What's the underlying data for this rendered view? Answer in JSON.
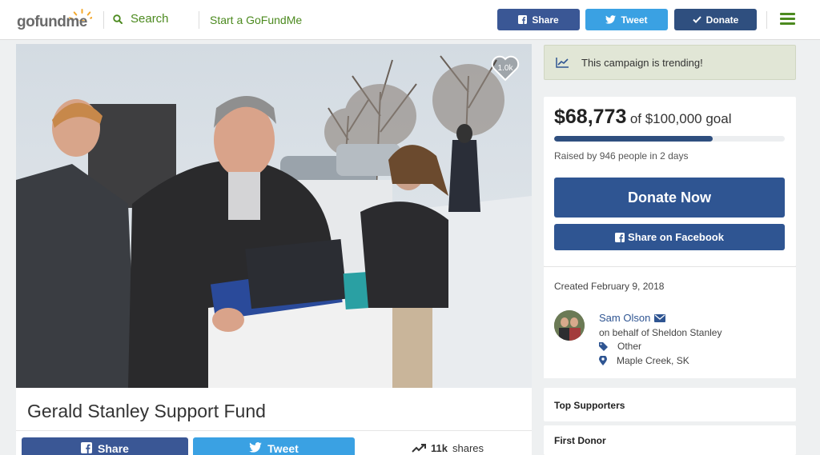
{
  "header": {
    "logo": {
      "part1": "go",
      "part2": "fund",
      "part3": "me"
    },
    "search_label": "Search",
    "start_label": "Start a GoFundMe",
    "share_label": "Share",
    "tweet_label": "Tweet",
    "donate_label": "Donate"
  },
  "hero": {
    "heart_count": "1.0k",
    "photo_icon": "campaign-photo"
  },
  "campaign": {
    "title": "Gerald Stanley Support Fund",
    "share_label": "Share",
    "tweet_label": "Tweet",
    "shares_count": "11k",
    "shares_suffix": "shares"
  },
  "sidebar": {
    "trending_text": "This campaign is trending!",
    "amount_raised": "$68,773",
    "goal_text": "of $100,000 goal",
    "progress_fraction": 0.68773,
    "raised_by": "Raised by 946 people in 2 days",
    "donate_now_label": "Donate Now",
    "share_facebook_label": "Share on Facebook",
    "created": "Created February 9, 2018",
    "organizer_name": "Sam Olson",
    "on_behalf": "on behalf of Sheldon Stanley",
    "category": "Other",
    "location": "Maple Creek, SK",
    "top_supporters_label": "Top Supporters",
    "first_donor_label": "First Donor"
  },
  "colors": {
    "brand_green": "#4c8a1f",
    "facebook_blue": "#3a5795",
    "twitter_blue": "#3aa1e3",
    "donate_navy": "#2f5592",
    "trending_bg": "#e1e6d6"
  }
}
